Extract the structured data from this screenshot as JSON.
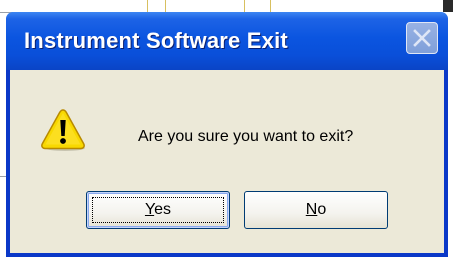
{
  "dialog": {
    "title": "Instrument Software Exit",
    "message": "Are you sure you want to exit?",
    "icon": "warning-icon",
    "close_icon": "close-icon",
    "buttons": {
      "yes": {
        "accel": "Y",
        "rest": "es"
      },
      "no": {
        "accel": "N",
        "rest": "o"
      }
    }
  },
  "colors": {
    "titlebar": "#0a4fd9",
    "client": "#ece9d8",
    "warning_fill": "#f8d800",
    "button_border": "#003c74"
  }
}
